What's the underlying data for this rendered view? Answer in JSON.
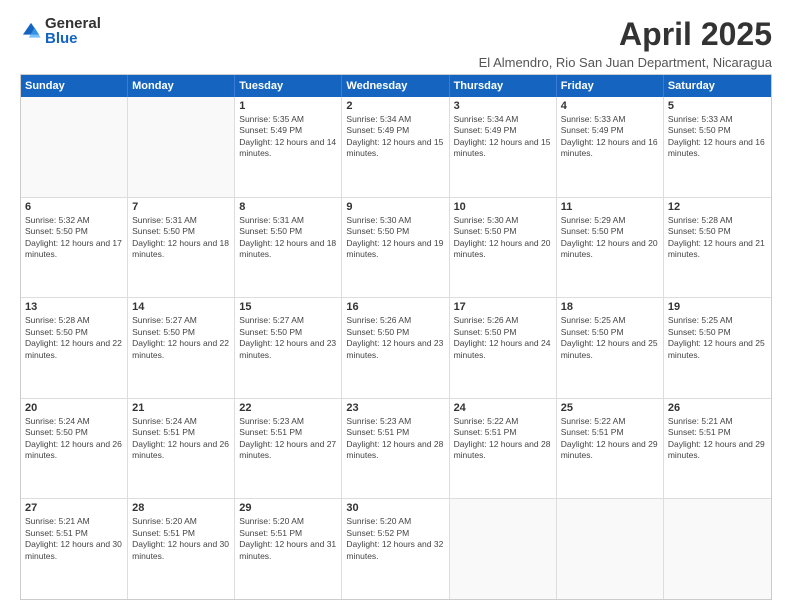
{
  "logo": {
    "general": "General",
    "blue": "Blue"
  },
  "title": "April 2025",
  "subtitle": "El Almendro, Rio San Juan Department, Nicaragua",
  "header_days": [
    "Sunday",
    "Monday",
    "Tuesday",
    "Wednesday",
    "Thursday",
    "Friday",
    "Saturday"
  ],
  "rows": [
    [
      {
        "day": "",
        "empty": true
      },
      {
        "day": "",
        "empty": true
      },
      {
        "day": "1",
        "sunrise": "5:35 AM",
        "sunset": "5:49 PM",
        "daylight": "12 hours and 14 minutes."
      },
      {
        "day": "2",
        "sunrise": "5:34 AM",
        "sunset": "5:49 PM",
        "daylight": "12 hours and 15 minutes."
      },
      {
        "day": "3",
        "sunrise": "5:34 AM",
        "sunset": "5:49 PM",
        "daylight": "12 hours and 15 minutes."
      },
      {
        "day": "4",
        "sunrise": "5:33 AM",
        "sunset": "5:49 PM",
        "daylight": "12 hours and 16 minutes."
      },
      {
        "day": "5",
        "sunrise": "5:33 AM",
        "sunset": "5:50 PM",
        "daylight": "12 hours and 16 minutes."
      }
    ],
    [
      {
        "day": "6",
        "sunrise": "5:32 AM",
        "sunset": "5:50 PM",
        "daylight": "12 hours and 17 minutes."
      },
      {
        "day": "7",
        "sunrise": "5:31 AM",
        "sunset": "5:50 PM",
        "daylight": "12 hours and 18 minutes."
      },
      {
        "day": "8",
        "sunrise": "5:31 AM",
        "sunset": "5:50 PM",
        "daylight": "12 hours and 18 minutes."
      },
      {
        "day": "9",
        "sunrise": "5:30 AM",
        "sunset": "5:50 PM",
        "daylight": "12 hours and 19 minutes."
      },
      {
        "day": "10",
        "sunrise": "5:30 AM",
        "sunset": "5:50 PM",
        "daylight": "12 hours and 20 minutes."
      },
      {
        "day": "11",
        "sunrise": "5:29 AM",
        "sunset": "5:50 PM",
        "daylight": "12 hours and 20 minutes."
      },
      {
        "day": "12",
        "sunrise": "5:28 AM",
        "sunset": "5:50 PM",
        "daylight": "12 hours and 21 minutes."
      }
    ],
    [
      {
        "day": "13",
        "sunrise": "5:28 AM",
        "sunset": "5:50 PM",
        "daylight": "12 hours and 22 minutes."
      },
      {
        "day": "14",
        "sunrise": "5:27 AM",
        "sunset": "5:50 PM",
        "daylight": "12 hours and 22 minutes."
      },
      {
        "day": "15",
        "sunrise": "5:27 AM",
        "sunset": "5:50 PM",
        "daylight": "12 hours and 23 minutes."
      },
      {
        "day": "16",
        "sunrise": "5:26 AM",
        "sunset": "5:50 PM",
        "daylight": "12 hours and 23 minutes."
      },
      {
        "day": "17",
        "sunrise": "5:26 AM",
        "sunset": "5:50 PM",
        "daylight": "12 hours and 24 minutes."
      },
      {
        "day": "18",
        "sunrise": "5:25 AM",
        "sunset": "5:50 PM",
        "daylight": "12 hours and 25 minutes."
      },
      {
        "day": "19",
        "sunrise": "5:25 AM",
        "sunset": "5:50 PM",
        "daylight": "12 hours and 25 minutes."
      }
    ],
    [
      {
        "day": "20",
        "sunrise": "5:24 AM",
        "sunset": "5:50 PM",
        "daylight": "12 hours and 26 minutes."
      },
      {
        "day": "21",
        "sunrise": "5:24 AM",
        "sunset": "5:51 PM",
        "daylight": "12 hours and 26 minutes."
      },
      {
        "day": "22",
        "sunrise": "5:23 AM",
        "sunset": "5:51 PM",
        "daylight": "12 hours and 27 minutes."
      },
      {
        "day": "23",
        "sunrise": "5:23 AM",
        "sunset": "5:51 PM",
        "daylight": "12 hours and 28 minutes."
      },
      {
        "day": "24",
        "sunrise": "5:22 AM",
        "sunset": "5:51 PM",
        "daylight": "12 hours and 28 minutes."
      },
      {
        "day": "25",
        "sunrise": "5:22 AM",
        "sunset": "5:51 PM",
        "daylight": "12 hours and 29 minutes."
      },
      {
        "day": "26",
        "sunrise": "5:21 AM",
        "sunset": "5:51 PM",
        "daylight": "12 hours and 29 minutes."
      }
    ],
    [
      {
        "day": "27",
        "sunrise": "5:21 AM",
        "sunset": "5:51 PM",
        "daylight": "12 hours and 30 minutes."
      },
      {
        "day": "28",
        "sunrise": "5:20 AM",
        "sunset": "5:51 PM",
        "daylight": "12 hours and 30 minutes."
      },
      {
        "day": "29",
        "sunrise": "5:20 AM",
        "sunset": "5:51 PM",
        "daylight": "12 hours and 31 minutes."
      },
      {
        "day": "30",
        "sunrise": "5:20 AM",
        "sunset": "5:52 PM",
        "daylight": "12 hours and 32 minutes."
      },
      {
        "day": "",
        "empty": true
      },
      {
        "day": "",
        "empty": true
      },
      {
        "day": "",
        "empty": true
      }
    ]
  ]
}
